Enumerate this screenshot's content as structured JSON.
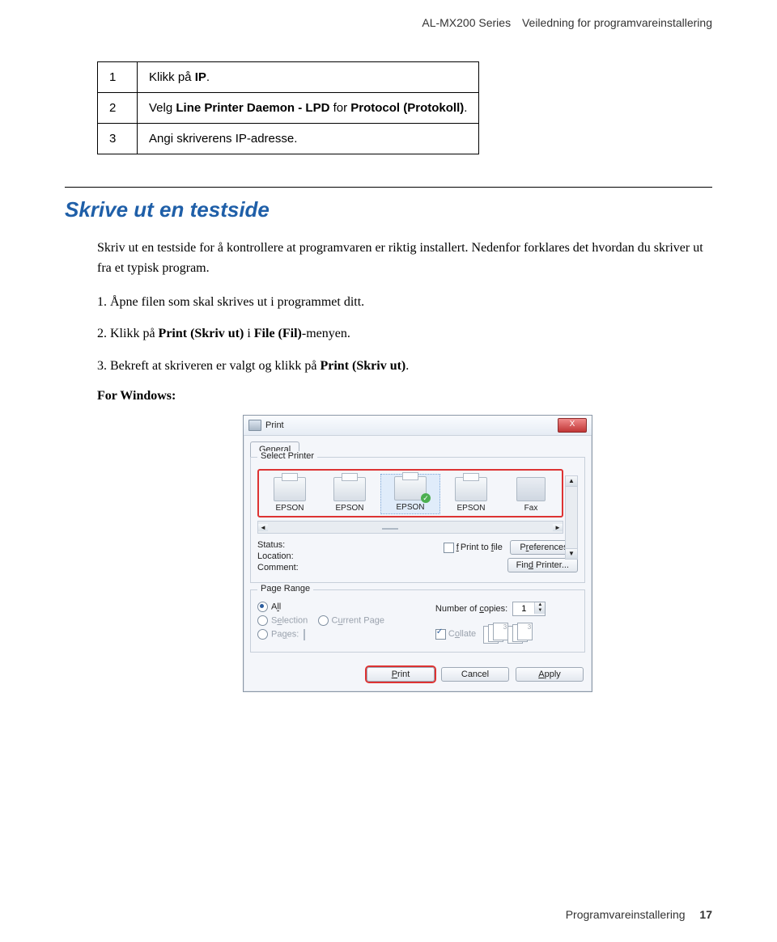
{
  "header": {
    "model": "AL-MX200 Series",
    "doc_title": "Veiledning for programvareinstallering"
  },
  "steps_table": {
    "rows": [
      {
        "n": "1",
        "text_pre": "Klikk på ",
        "bold": "IP",
        "text_post": "."
      },
      {
        "n": "2",
        "text_pre": "Velg ",
        "bold": "Line Printer Daemon - LPD",
        "text_mid": " for ",
        "bold2": "Protocol (Protokoll)",
        "text_post": "."
      },
      {
        "n": "3",
        "text_pre": "Angi skriverens IP-adresse.",
        "bold": "",
        "text_post": ""
      }
    ]
  },
  "section": {
    "heading": "Skrive ut en testside",
    "para1": "Skriv ut en testside for å kontrollere at programvaren er riktig installert. Nedenfor forklares det hvordan du skriver ut fra et typisk program.",
    "item1_pre": "1.   Åpne filen som skal skrives ut i programmet ditt.",
    "item2_pre": "2.   Klikk på ",
    "item2_b1": "Print (Skriv ut)",
    "item2_mid": " i ",
    "item2_b2": "File (Fil)",
    "item2_post": "-menyen.",
    "item3_pre": "3.   Bekreft at skriveren er valgt og klikk på ",
    "item3_b1": "Print (Skriv ut)",
    "item3_post": ".",
    "for_windows": "For Windows:"
  },
  "dialog": {
    "title": "Print",
    "close": "X",
    "tab": "General",
    "group_select": "Select Printer",
    "printers": [
      "EPSON",
      "EPSON",
      "EPSON",
      "EPSON",
      "Fax"
    ],
    "status_label": "Status:",
    "location_label": "Location:",
    "comment_label": "Comment:",
    "print_to_file": "Print to file",
    "preferences": "Preferences",
    "find_printer": "Find Printer...",
    "page_range_label": "Page Range",
    "all": "All",
    "selection": "Selection",
    "current_page": "Current Page",
    "pages": "Pages:",
    "copies_label": "Number of copies:",
    "copies_value": "1",
    "collate": "Collate",
    "btn_print": "Print",
    "btn_cancel": "Cancel",
    "btn_apply": "Apply"
  },
  "footer": {
    "section": "Programvareinstallering",
    "page": "17"
  }
}
